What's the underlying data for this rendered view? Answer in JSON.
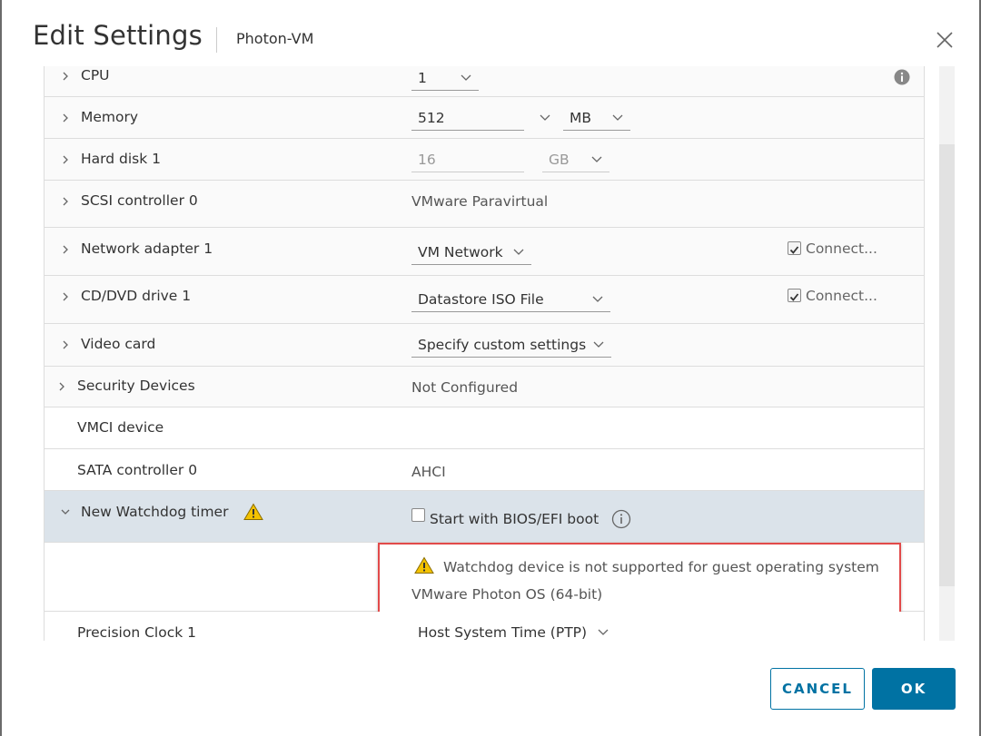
{
  "dialog": {
    "title": "Edit Settings",
    "vm_name": "Photon-VM",
    "close_icon": "close-icon"
  },
  "rows": {
    "cpu": {
      "label": "CPU",
      "value": "1"
    },
    "memory": {
      "label": "Memory",
      "value": "512",
      "unit": "MB"
    },
    "hard_disk": {
      "label": "Hard disk 1",
      "value": "16",
      "unit": "GB"
    },
    "scsi": {
      "label": "SCSI controller 0",
      "value": "VMware Paravirtual"
    },
    "network": {
      "label": "Network adapter 1",
      "value": "VM Network",
      "connect_label": "Connect...",
      "connected": true
    },
    "cddvd": {
      "label": "CD/DVD drive 1",
      "value": "Datastore ISO File",
      "connect_label": "Connect...",
      "connected": true
    },
    "video": {
      "label": "Video card",
      "value": "Specify custom settings"
    },
    "security": {
      "label": "Security Devices",
      "value": "Not Configured"
    },
    "vmci": {
      "label": "VMCI device"
    },
    "sata": {
      "label": "SATA controller 0",
      "value": "AHCI"
    },
    "watchdog": {
      "label": "New Watchdog timer",
      "checkbox_label": "Start with BIOS/EFI boot",
      "checked": false
    },
    "watchdog_warning": {
      "line1": "Watchdog device is not supported for guest operating system",
      "line2": "VMware Photon OS (64-bit)"
    },
    "precision": {
      "label": "Precision Clock 1",
      "value": "Host System Time (PTP)"
    }
  },
  "buttons": {
    "cancel": "CANCEL",
    "ok": "OK"
  },
  "colors": {
    "primary": "#0072a3",
    "warning_border": "#e24a4a",
    "selected_row": "#dbe3ea",
    "warning_icon": "#f3c200"
  }
}
